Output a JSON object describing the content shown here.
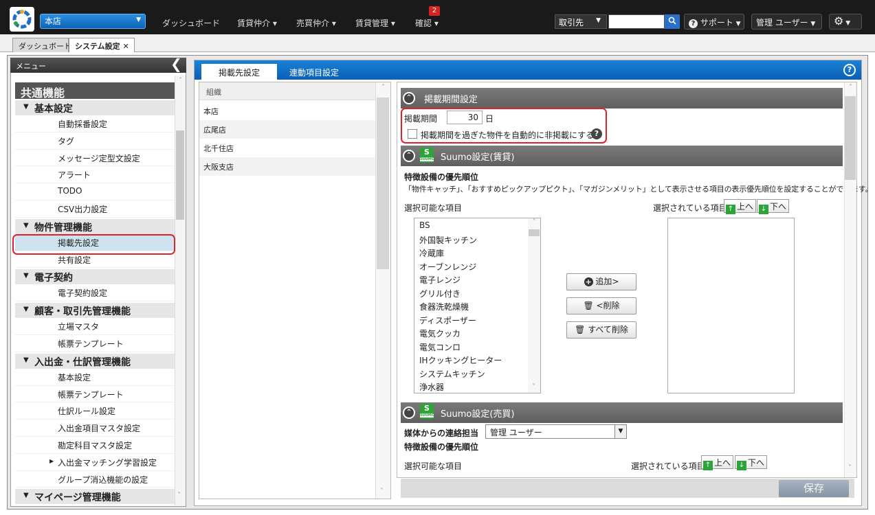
{
  "topbar": {
    "store": "本店",
    "nav": [
      {
        "label": "ダッシュボード"
      },
      {
        "label": "賃貸仲介 ▾"
      },
      {
        "label": "売買仲介 ▾"
      },
      {
        "label": "賃貸管理 ▾"
      },
      {
        "label": "確認 ▾"
      }
    ],
    "confirm_badge": "2",
    "client_select": "取引先",
    "support": "サポート",
    "user": "管理 ユーザー"
  },
  "page_tabs": [
    {
      "label": "ダッシュボード"
    },
    {
      "label": "システム設定 ✕"
    }
  ],
  "sidebar": {
    "title": "メニュー",
    "category": "共通機能",
    "groups": [
      {
        "label": "基本設定",
        "items": [
          "自動採番設定",
          "タグ",
          "メッセージ定型文設定",
          "アラート",
          "TODO",
          "CSV出力設定"
        ]
      },
      {
        "label": "物件管理機能",
        "items": [
          "掲載先設定",
          "共有設定"
        ]
      },
      {
        "label": "電子契約",
        "items": [
          "電子契約設定"
        ]
      },
      {
        "label": "顧客・取引先管理機能",
        "items": [
          "立場マスタ",
          "帳票テンプレート"
        ]
      },
      {
        "label": "入出金・仕訳管理機能",
        "items": [
          "基本設定",
          "帳票テンプレート",
          "仕訳ルール設定",
          "入出金項目マスタ設定",
          "勘定科目マスタ設定",
          "入出金マッチング学習設定",
          "グループ消込機能の設定"
        ]
      },
      {
        "label": "マイページ管理機能",
        "items": []
      }
    ]
  },
  "main": {
    "tabs": [
      {
        "label": "掲載先設定"
      },
      {
        "label": "連動項目設定"
      }
    ],
    "org_header": "組織",
    "orgs": [
      "本店",
      "広尾店",
      "北千住店",
      "大阪支店"
    ],
    "period_section": {
      "title": "掲載期間設定",
      "period_label": "掲載期間",
      "period_value": "30",
      "period_unit": "日",
      "auto_hide_label": "掲載期間を過ぎた物件を自動的に非掲載にする。"
    },
    "rent_section": {
      "title": "Suumo設定(賃貸)",
      "priority_title": "特徴設備の優先順位",
      "description": "「物件キャッチ」、「おすすめピックアップピクト」、「マガジンメリット」として表示させる項目の表示優先順位を設定することができます。",
      "available_label": "選択可能な項目",
      "selected_label": "選択されている項目",
      "up_label": "上へ",
      "down_label": "下へ",
      "available_items": [
        "BS",
        "外国製キッチン",
        "冷蔵庫",
        "オーブンレンジ",
        "電子レンジ",
        "グリル付き",
        "食器洗乾燥機",
        "ディスポーザー",
        "電気クッカ",
        "電気コンロ",
        "IHクッキングヒーター",
        "システムキッチン",
        "浄水器"
      ],
      "add_button": "追加>",
      "remove_button": "<削除",
      "remove_all_button": "すべて削除"
    },
    "sale_section": {
      "title": "Suumo設定(売買)",
      "contact_label": "媒体からの連絡担当",
      "contact_value": "管理 ユーザー",
      "priority_title": "特徴設備の優先順位",
      "available_label": "選択可能な項目",
      "selected_label": "選択されている項目",
      "up_label": "上へ",
      "down_label": "下へ"
    },
    "save_button": "保存"
  },
  "suumo_logo": {
    "letter": "S",
    "small": "SUUMO"
  },
  "colors": {
    "highlight": "#e0202b",
    "tab_blue": "#0a5fb4",
    "suumo_green": "#2ea33a"
  }
}
